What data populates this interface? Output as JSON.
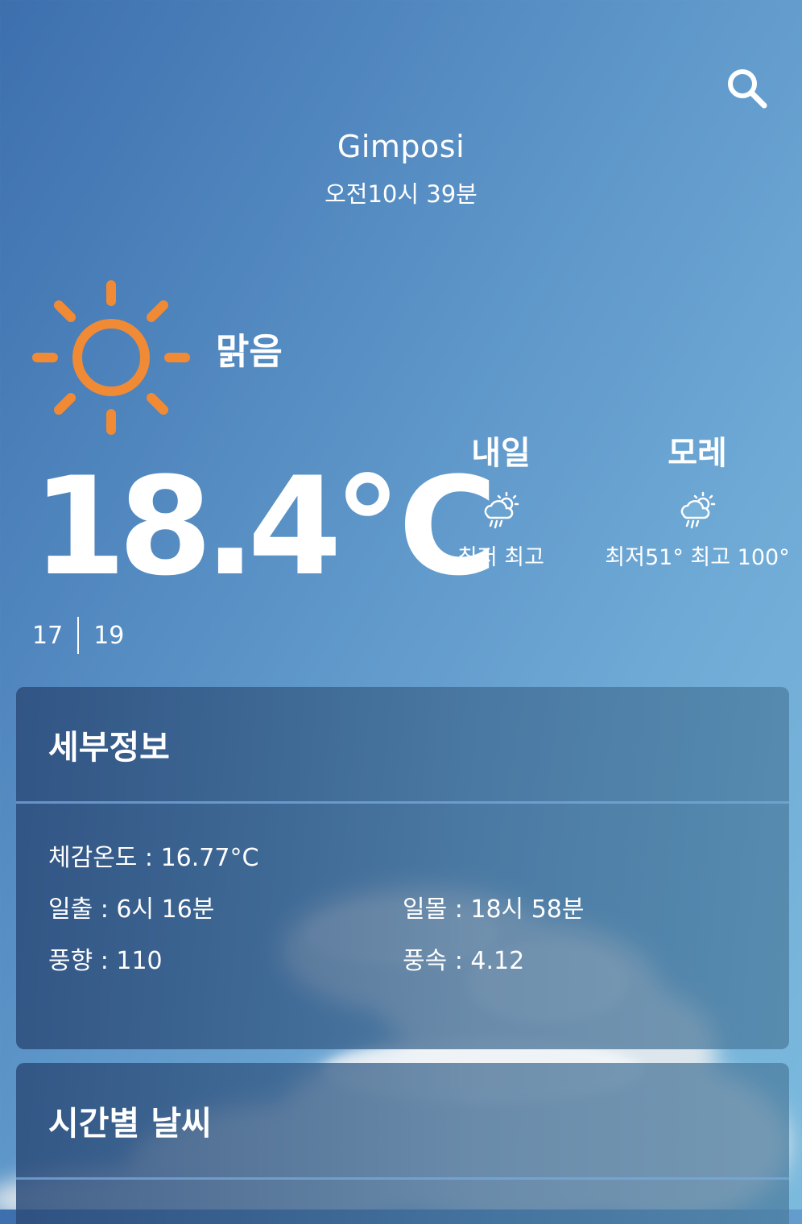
{
  "location": {
    "city": "Gimposi",
    "time": "오전10시 39분"
  },
  "current": {
    "condition": "맑음",
    "temperature": "18.4℃",
    "min": "17",
    "max": "19",
    "icon": "sun-icon"
  },
  "forecast": [
    {
      "day": "내일",
      "icon": "rain-cloud-sun-icon",
      "range": "최저 최고"
    },
    {
      "day": "모레",
      "icon": "rain-cloud-sun-icon",
      "range": "최저51° 최고 100°"
    }
  ],
  "details": {
    "title": "세부정보",
    "feels_like": "체감온도 : 16.77°C",
    "sunrise": "일출 : 6시 16분",
    "sunset": "일몰 : 18시 58분",
    "wind_dir": "풍향 : 110",
    "wind_speed": "풍속 : 4.12"
  },
  "hourly": {
    "title": "시간별 날씨"
  },
  "colors": {
    "sun": "#f08a34",
    "bg_start": "#3d6fae",
    "bg_end": "#7bbadd"
  }
}
